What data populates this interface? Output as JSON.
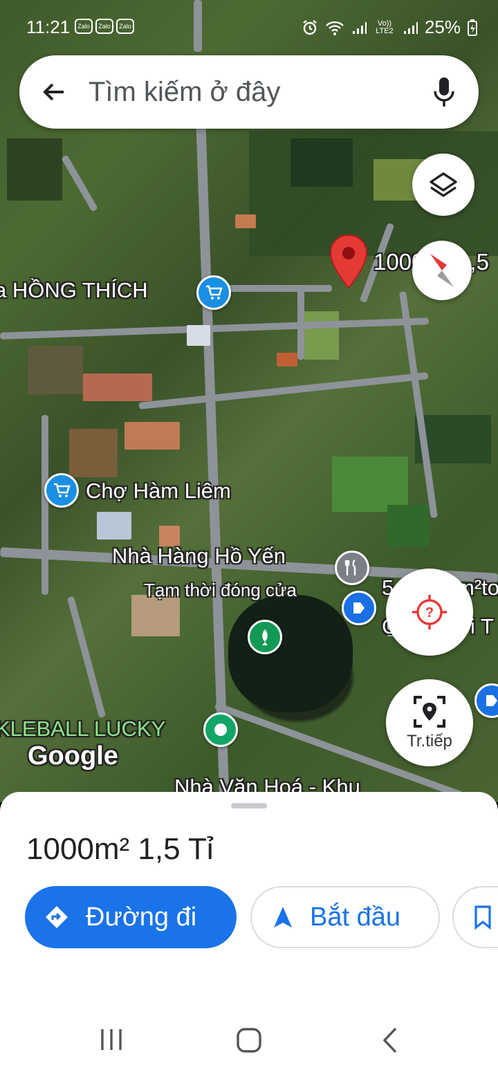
{
  "status_bar": {
    "time": "11:21",
    "notification_icons": [
      "Zalo",
      "Zalo",
      "Zalo"
    ],
    "network": "Vo)) LTE2",
    "battery": "25%"
  },
  "search": {
    "placeholder": "Tìm kiếm ở đây"
  },
  "map": {
    "pin_label": "1000m² 1,5",
    "labels": {
      "hong_thich": "a HỒNG THÍCH",
      "cho_ham_liem": "Chợ Hàm Liêm",
      "restaurant": "Nhà Hàng Hồ Yến",
      "restaurant_status": "Tạm thời đóng cửa",
      "right_cut": "5",
      "right_cut2": "m²to",
      "right_cut3": "C",
      "right_cut4": "i T",
      "pickleball": "KLEBALL LUCKY",
      "google": "Google",
      "cultural_house": "Nhà Văn Hoá - Khu"
    }
  },
  "fabs": {
    "live_label": "Tr.tiếp"
  },
  "place": {
    "title": "1000m² 1,5 Tỉ",
    "directions_label": "Đường đi",
    "start_label": "Bắt đầu"
  },
  "colors": {
    "accent": "#1a73e8",
    "pin": "#e53935"
  }
}
